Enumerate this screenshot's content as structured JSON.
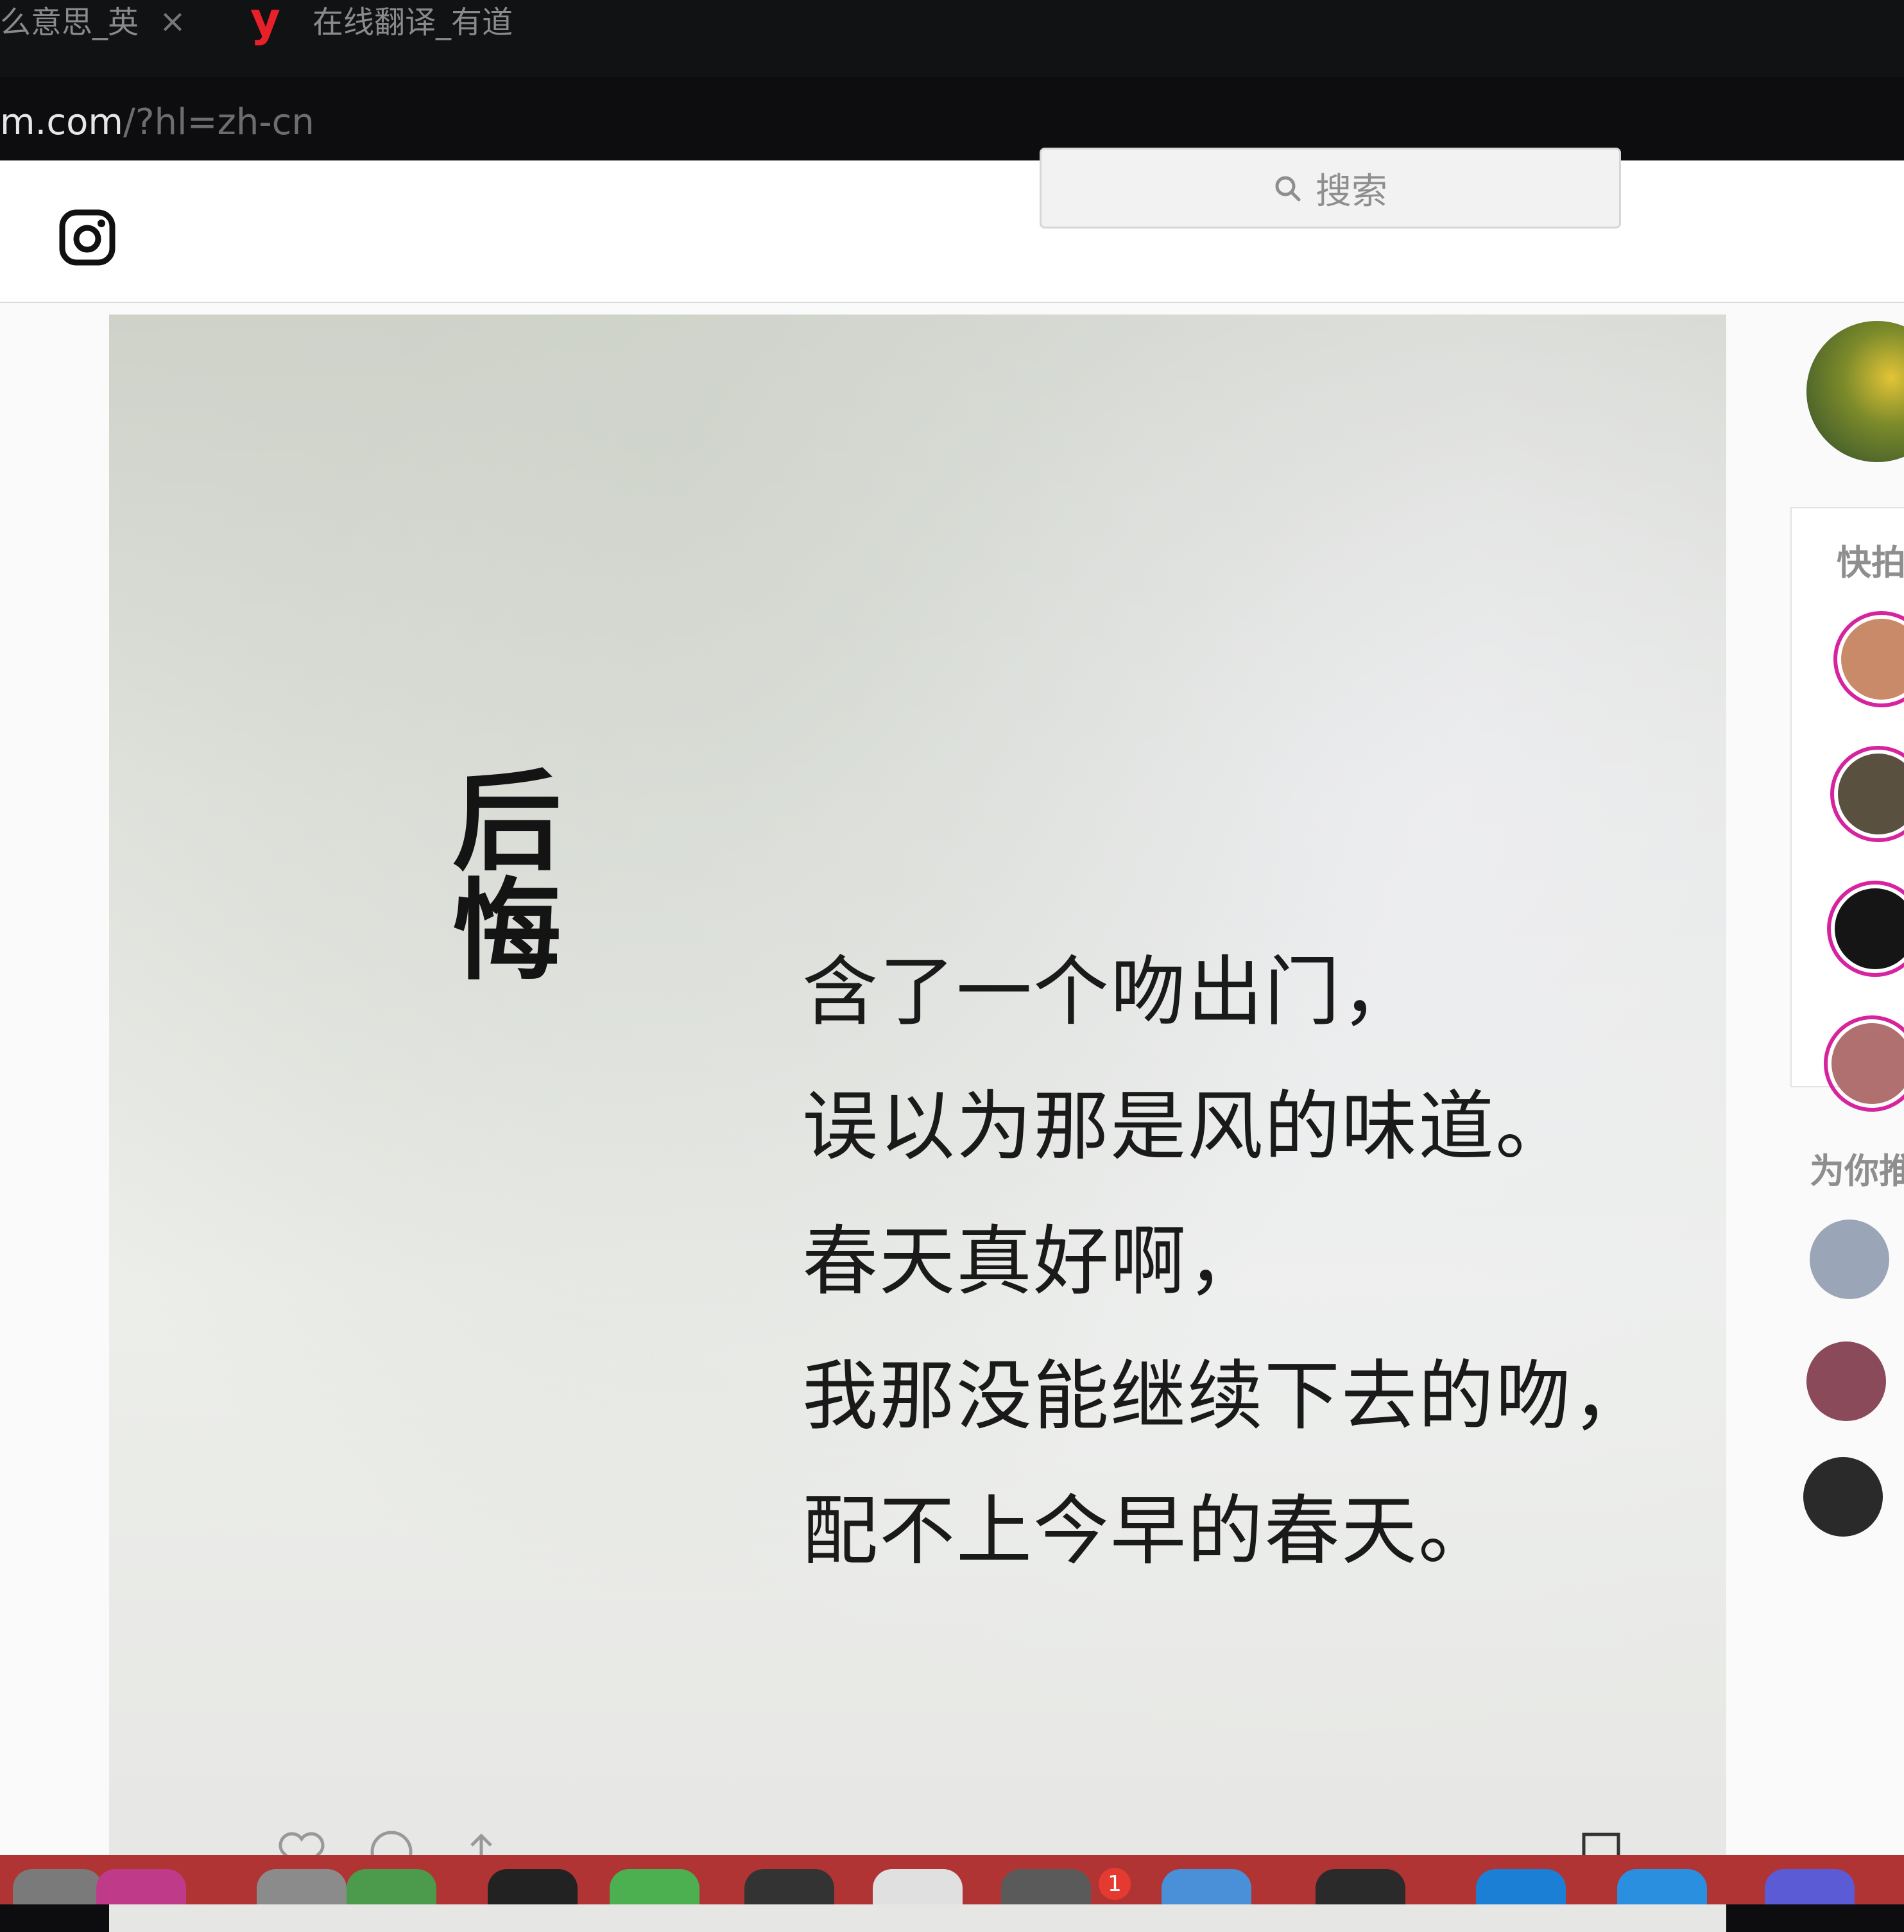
{
  "browser": {
    "tabs": [
      {
        "title": "么意思_英",
        "close": "×"
      },
      {
        "logo": "y",
        "title": "在线翻译_有道"
      }
    ],
    "url": {
      "domain": "m.com",
      "path": "/?hl=zh-cn"
    }
  },
  "nav": {
    "logo": "instagram-icon",
    "search_placeholder": "搜索"
  },
  "post": {
    "title": "后悔",
    "lines": [
      "含了一个吻出门，",
      "误以为那是风的味道。",
      "春天真好啊，",
      "我那没能继续下去的吻，",
      "配不上今早的春天。"
    ]
  },
  "sidebar": {
    "stories_heading": "快拍",
    "suggestions_heading": "为你推"
  },
  "dock": {
    "badge": "1"
  },
  "colors": {
    "youdao_red": "#e8202a",
    "story_ring": "#d6249f",
    "dock_red": "#b03433"
  }
}
